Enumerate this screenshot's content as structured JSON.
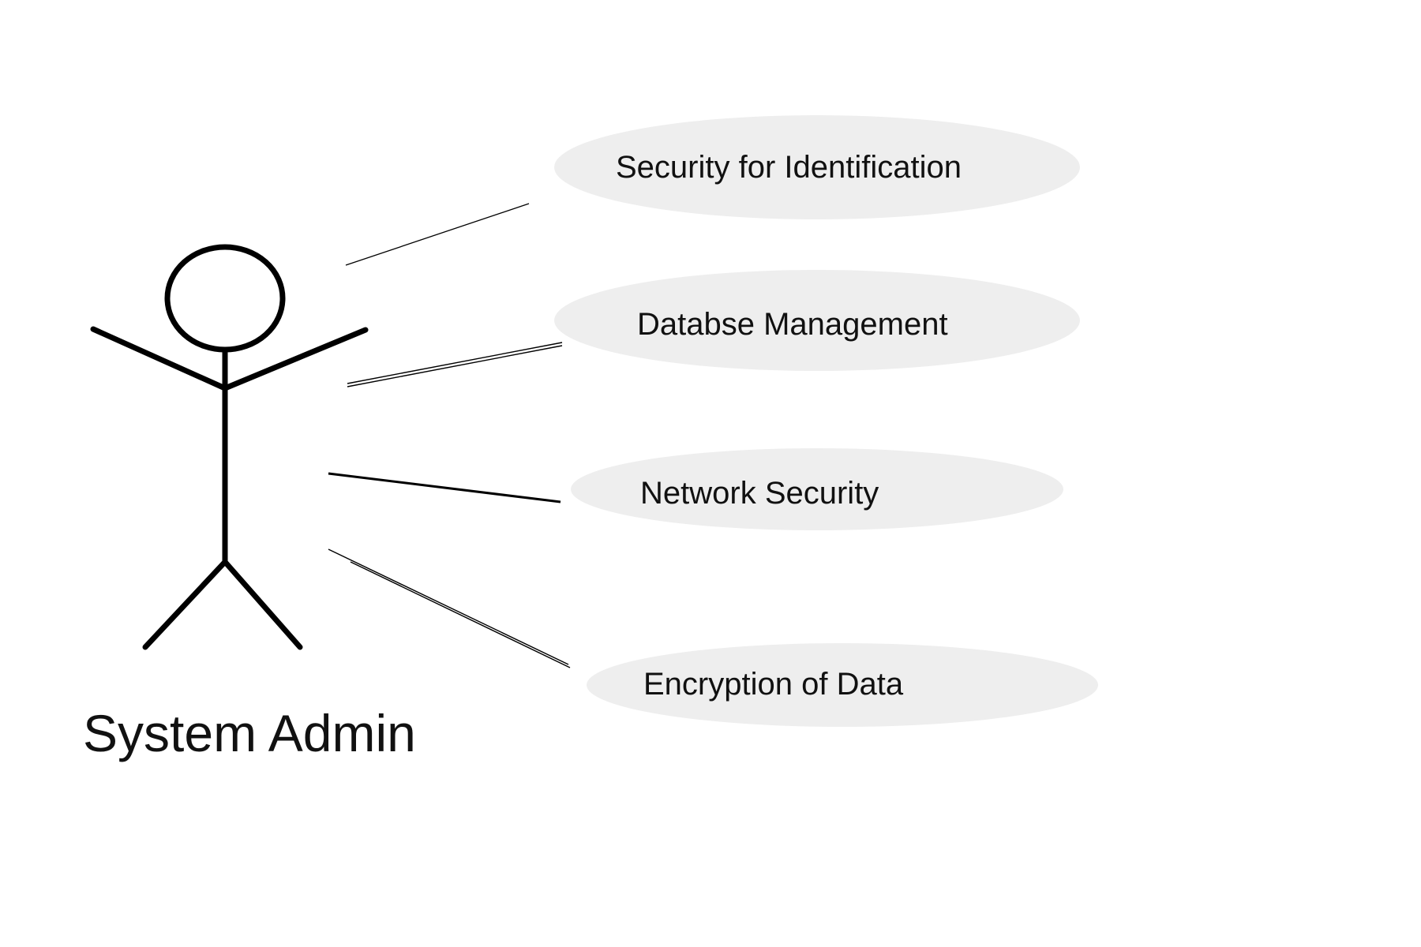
{
  "actor": {
    "name": "System Admin",
    "icon": "stick-figure-icon"
  },
  "use_cases": [
    {
      "label": "Security for Identification"
    },
    {
      "label": "Databse Management"
    },
    {
      "label": "Network Security"
    },
    {
      "label": "Encryption of Data"
    }
  ],
  "colors": {
    "ellipse_fill": "#eeeeee",
    "line": "#000000",
    "text": "#111111"
  }
}
